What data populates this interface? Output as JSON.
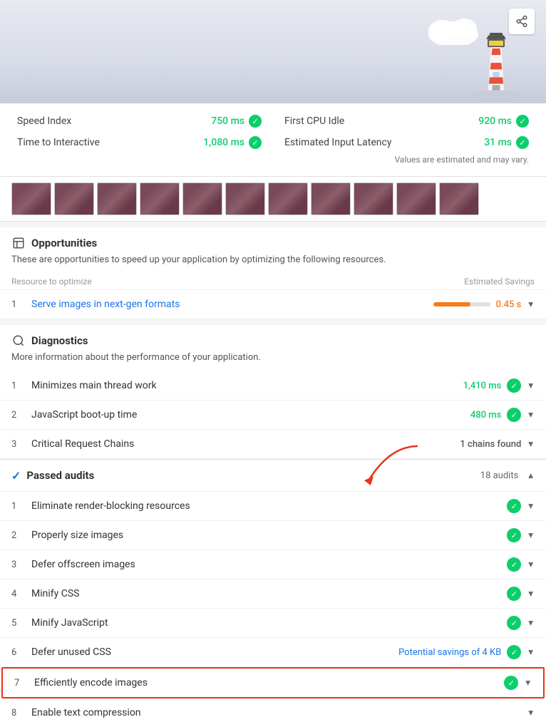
{
  "header": {
    "share_label": "Share"
  },
  "metrics": {
    "note": "Values are estimated and may vary.",
    "items": [
      {
        "label": "Speed Index",
        "value": "750 ms",
        "col": 1
      },
      {
        "label": "First CPU Idle",
        "value": "920 ms",
        "col": 2
      },
      {
        "label": "Time to Interactive",
        "value": "1,080 ms",
        "col": 1
      },
      {
        "label": "Estimated Input Latency",
        "value": "31 ms",
        "col": 2
      }
    ]
  },
  "opportunities": {
    "title": "Opportunities",
    "description": "These are opportunities to speed up your application by optimizing the following resources.",
    "table_col1": "Resource to optimize",
    "table_col2": "Estimated Savings",
    "items": [
      {
        "num": "1",
        "label": "Serve images in next-gen formats",
        "value": "0.45 s",
        "bar_pct": 65
      }
    ]
  },
  "diagnostics": {
    "title": "Diagnostics",
    "description": "More information about the performance of your application.",
    "items": [
      {
        "num": "1",
        "label": "Minimizes main thread work",
        "value": "1,410 ms",
        "type": "green"
      },
      {
        "num": "2",
        "label": "JavaScript boot-up time",
        "value": "480 ms",
        "type": "green"
      },
      {
        "num": "3",
        "label": "Critical Request Chains",
        "value": "1 chains found",
        "type": "gray"
      }
    ]
  },
  "passed_audits": {
    "title": "Passed audits",
    "count": "18 audits",
    "items": [
      {
        "num": "1",
        "label": "Eliminate render-blocking resources",
        "type": "green"
      },
      {
        "num": "2",
        "label": "Properly size images",
        "type": "green"
      },
      {
        "num": "3",
        "label": "Defer offscreen images",
        "type": "green"
      },
      {
        "num": "4",
        "label": "Minify CSS",
        "type": "green"
      },
      {
        "num": "5",
        "label": "Minify JavaScript",
        "type": "green"
      },
      {
        "num": "6",
        "label": "Defer unused CSS",
        "type": "green",
        "extra": "Potential savings of 4 KB"
      },
      {
        "num": "7",
        "label": "Efficiently encode images",
        "type": "green",
        "highlighted": true
      },
      {
        "num": "8",
        "label": "Enable text compression",
        "type": "none"
      }
    ]
  },
  "icons": {
    "share": "⬆",
    "opportunities": "📋",
    "diagnostics": "🔍",
    "check": "✓",
    "chevron_down": "▾",
    "chevron_up": "▴"
  }
}
